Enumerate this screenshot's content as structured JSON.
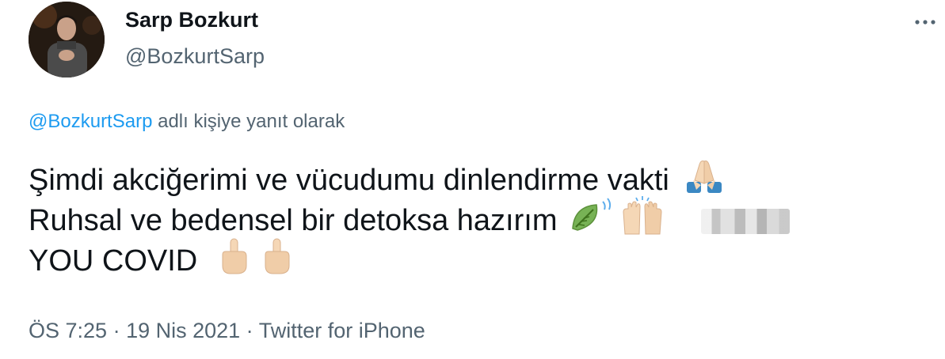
{
  "user": {
    "display_name": "Sarp Bozkurt",
    "handle": "@BozkurtSarp",
    "avatar_icon": "profile-photo"
  },
  "menu_icon": "more-horizontal-icon",
  "reply_context": {
    "mention": "@BozkurtSarp",
    "suffix": " adlı kişiye yanıt olarak"
  },
  "tweet": {
    "line1": "Şimdi akciğerimi ve vücudumu dinlendirme vakti",
    "line2": "Ruhsal ve bedensel bir detoksa hazırım",
    "line3": "YOU COVID",
    "emojis": [
      "folded-hands-icon",
      "leaf-fluttering-icon",
      "raising-hands-icon",
      "middle-finger-icon",
      "middle-finger-icon"
    ]
  },
  "meta": {
    "time": "ÖS 7:25",
    "sep1": " · ",
    "date": "19 Nis 2021",
    "sep2": " · ",
    "source": "Twitter for iPhone"
  },
  "colors": {
    "text": "#0f1419",
    "secondary": "#536471",
    "link": "#1d9bf0"
  }
}
